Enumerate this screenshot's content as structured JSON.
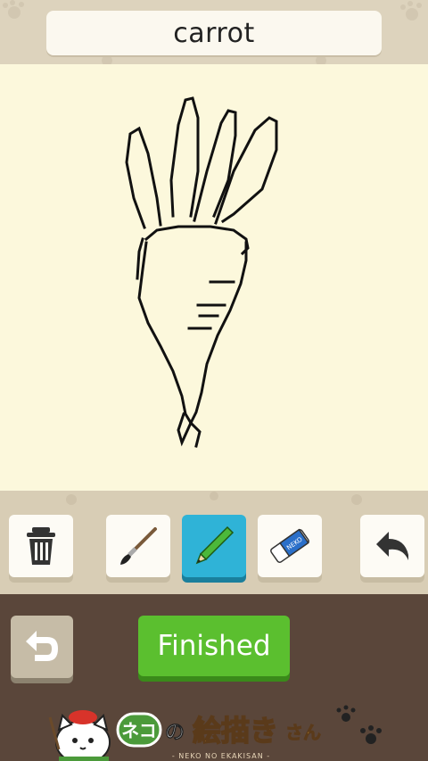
{
  "header": {
    "word": "carrot"
  },
  "toolbar": {
    "tools": [
      {
        "icon": "trash-icon",
        "active": false
      },
      {
        "icon": "paintbrush-icon",
        "active": false
      },
      {
        "icon": "pencil-icon",
        "active": true
      },
      {
        "icon": "eraser-icon",
        "active": false
      },
      {
        "icon": "undo-icon",
        "active": false
      }
    ],
    "eraser_text": "NEKO"
  },
  "footer": {
    "back_icon": "return-arrow-icon",
    "finish_label": "Finished"
  },
  "logo": {
    "title_part1": "ネコ",
    "title_part2": "の",
    "title_part3": "絵描き",
    "title_part4": "さん",
    "subtitle": "- NEKO NO EKAKISAN -"
  },
  "colors": {
    "canvas_bg": "#fcf8dc",
    "pencil_active": "#2fb3d7",
    "finish_button": "#5bbf2f",
    "frame": "#d8cdb5",
    "bottom_panel": "#5a463a"
  }
}
